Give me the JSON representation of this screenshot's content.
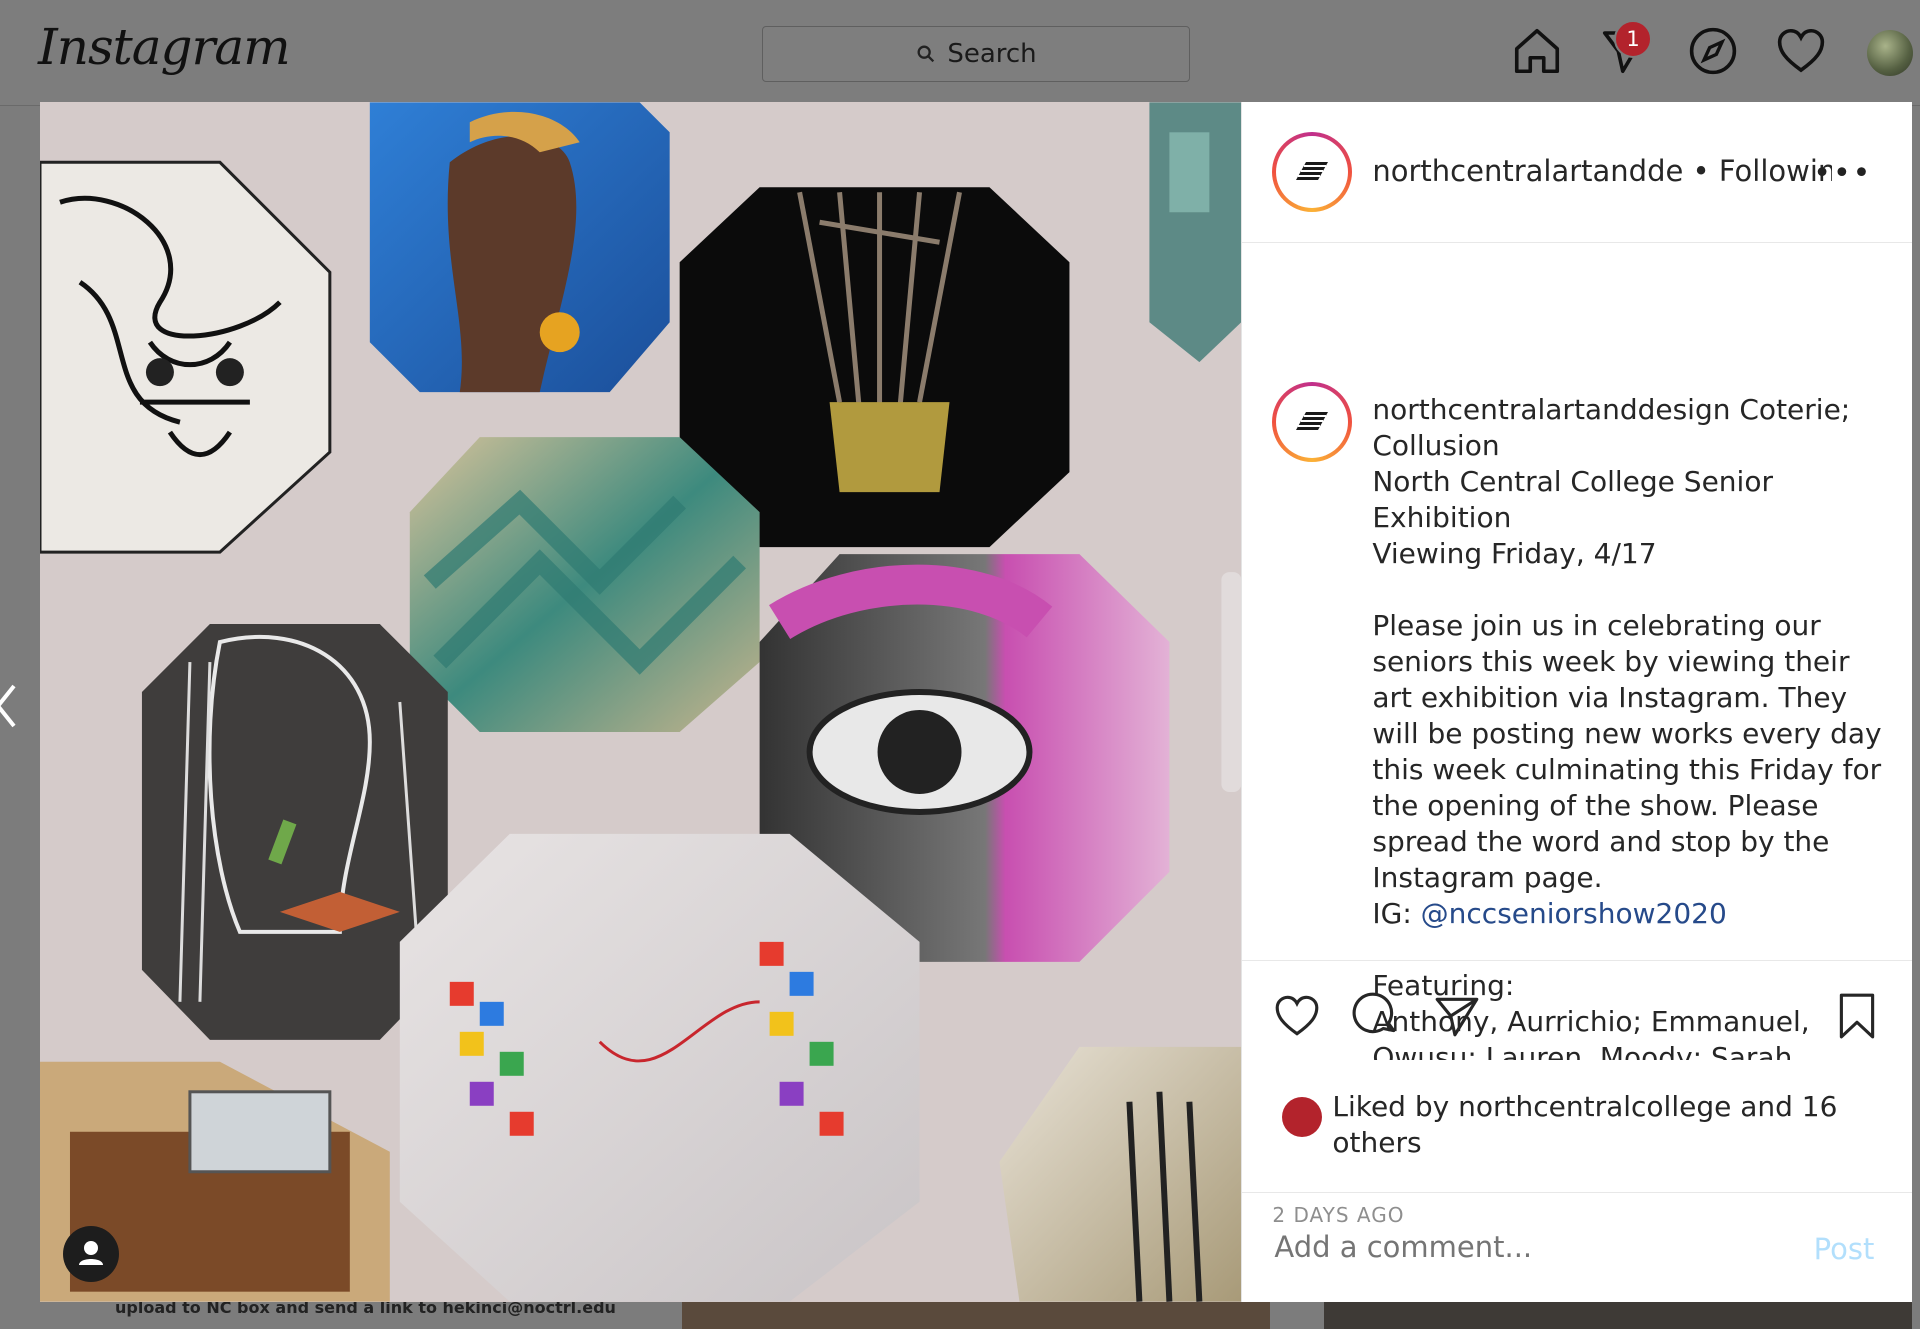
{
  "nav": {
    "logo": "Instagram",
    "search_placeholder": "Search",
    "notification_count": "1",
    "icons": [
      "home-icon",
      "direct-icon",
      "explore-icon",
      "heart-icon",
      "profile-avatar"
    ]
  },
  "background": {
    "caption_fragment": "upload to NC box and send a link to hekinci@noctrl.edu"
  },
  "post": {
    "header": {
      "username": "northcentralartandde",
      "separator": " • ",
      "follow_status": "Following",
      "more": "•••"
    },
    "caption": {
      "username": "northcentralartanddesign",
      "text_before_link": " Coterie; Collusion\nNorth Central College Senior Exhibition\nViewing Friday, 4/17\n\nPlease join us in celebrating our seniors this week by viewing their art exhibition via Instagram. They will be posting new works every day this week culminating this Friday for the opening of the show. Please spread the word and stop by the Instagram page.\nIG: ",
      "link": "@nccseniorshow2020",
      "text_after_link": "\n\nFeaturing:\nAnthony, Aurrichio; Emmanuel, Owusu; Lauren, Moody; Sarah"
    },
    "likes": {
      "prefix": "Liked by ",
      "liker": "northcentralcollege",
      "suffix": " and 16 others"
    },
    "timestamp": "2 DAYS AGO",
    "comment": {
      "placeholder": "Add a comment...",
      "post_label": "Post"
    }
  },
  "colors": {
    "link": "#264a8a",
    "post_disabled": "#b2dffc",
    "badge": "#b3232c",
    "overlay": "#7d7d7d"
  }
}
